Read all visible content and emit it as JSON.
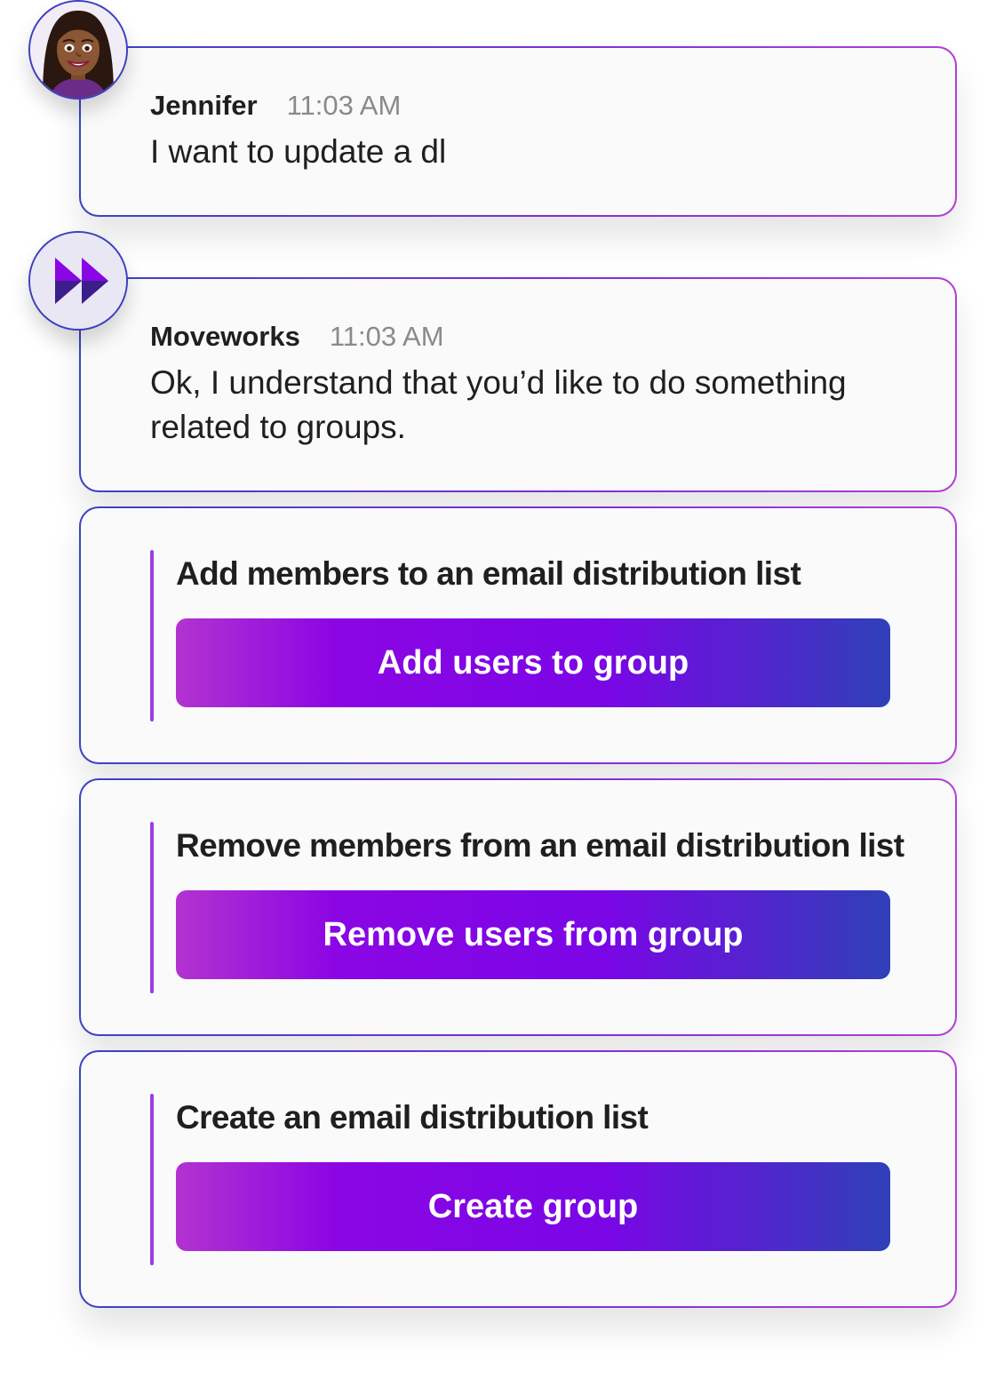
{
  "conversation": {
    "user_message": {
      "sender": "Jennifer",
      "time": "11:03 AM",
      "text": "I want to update a dl"
    },
    "bot_message": {
      "sender": "Moveworks",
      "time": "11:03 AM",
      "text": "Ok, I understand that you’d like to do something related to groups."
    },
    "options": [
      {
        "title": "Add members to an email distribution list",
        "button_label": "Add users to group"
      },
      {
        "title": "Remove members from an email distribution list",
        "button_label": "Remove users from group"
      },
      {
        "title": "Create an email distribution list",
        "button_label": "Create group"
      }
    ]
  },
  "icons": {
    "user_avatar": "bitmoji-woman-avatar-icon",
    "bot_avatar": "moveworks-logo-icon"
  },
  "colors": {
    "accent_purple": "#8a06e4",
    "accent_blue": "#2f40b8",
    "accent_magenta": "#b233d0",
    "avatar_border": "#3b3fc0"
  }
}
